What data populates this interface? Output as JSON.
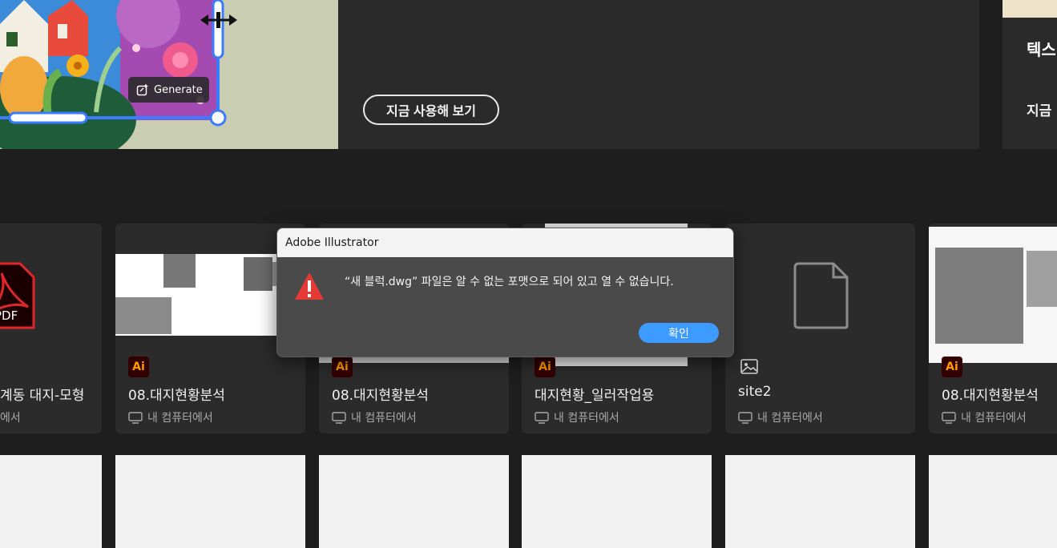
{
  "promo": {
    "generate_label": "Generate",
    "try_now_label": "지금 사용해 보기",
    "right_title": "텍스",
    "right_sub": "지금"
  },
  "files": [
    {
      "name": "계동 대지-모형",
      "location": "에서",
      "type": "pdf",
      "type_label": "PDF"
    },
    {
      "name": "08.대지현황분석",
      "location": "내 컴퓨터에서",
      "type": "ai",
      "type_label": "Ai"
    },
    {
      "name": "08.대지현황분석",
      "location": "내 컴퓨터에서",
      "type": "ai",
      "type_label": "Ai"
    },
    {
      "name": "대지현황_일러작업용",
      "location": "내 컴퓨터에서",
      "type": "ai",
      "type_label": "Ai"
    },
    {
      "name": "site2",
      "location": "내 컴퓨터에서",
      "type": "image",
      "type_label": ""
    },
    {
      "name": "08.대지현황분석",
      "location": "내 컴퓨터에서",
      "type": "ai",
      "type_label": "Ai"
    }
  ],
  "dialog": {
    "title": "Adobe Illustrator",
    "message": "“새 블럭.dwg” 파일은 알 수 없는 포맷으로 되어 있고 열 수 없습니다.",
    "ok_label": "확인"
  },
  "colors": {
    "background": "#1e1e1e",
    "card": "#2b2b2b",
    "ai_badge_bg": "#330000",
    "ai_badge_fg": "#ff9a00",
    "pdf_red": "#e0262b",
    "dialog_ok": "#3d9bff",
    "warning": "#e53935"
  }
}
